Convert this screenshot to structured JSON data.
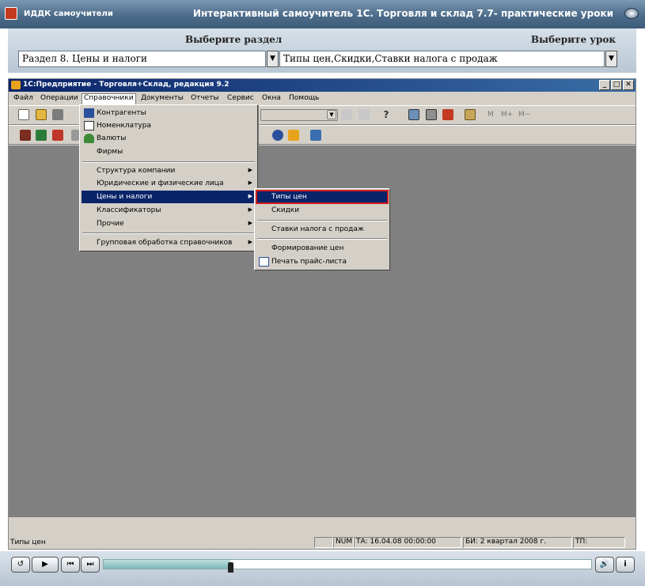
{
  "outer": {
    "app_name": "ИДДК самоучители",
    "title": "Интерактивный самоучитель 1С. Торговля и склад 7.7- практические уроки"
  },
  "selectors": {
    "section_header": "Выберите раздел",
    "lesson_header": "Выберите урок",
    "section_value": "Раздел 8. Цены и налоги",
    "lesson_value": "Типы цен,Скидки,Ставки налога с продаж"
  },
  "window": {
    "title": "1С:Предприятие - Торговля+Склад, редакция 9.2",
    "min": "_",
    "max": "□",
    "close": "✕"
  },
  "menubar": [
    "Файл",
    "Операции",
    "Справочники",
    "Документы",
    "Отчеты",
    "Сервис",
    "Окна",
    "Помощь"
  ],
  "toolbar": {
    "m": "M",
    "m_plus": "M+",
    "m_minus": "M−"
  },
  "ref_menu": {
    "items": [
      "Контрагенты",
      "Номенклатура",
      "Валюты",
      "Фирмы",
      "Структура компании",
      "Юридические и физические лица",
      "Цены и налоги",
      "Классификаторы",
      "Прочие",
      "Групповая обработка справочников"
    ],
    "highlighted": "Цены и налоги"
  },
  "prices_submenu": {
    "items": [
      "Типы цен",
      "Скидки",
      "Ставки налога с продаж",
      "Формирование цен",
      "Печать прайс-листа"
    ],
    "highlighted": "Типы цен"
  },
  "status": {
    "left": "Типы цен",
    "num": "NUM",
    "ta": "ТА: 16.04.08  00:00:00",
    "bi": "БИ: 2 квартал 2008 г.",
    "tp": "ТП:"
  },
  "player": {
    "progress_fraction": 0.26,
    "replay": "↺",
    "play": "▶",
    "prev": "⏮",
    "next": "⏭",
    "sound": "🔊",
    "info": "i"
  },
  "colors": {
    "highlight": "#0a246a",
    "highlight_frame": "#d21b1b",
    "client": "#808080"
  }
}
